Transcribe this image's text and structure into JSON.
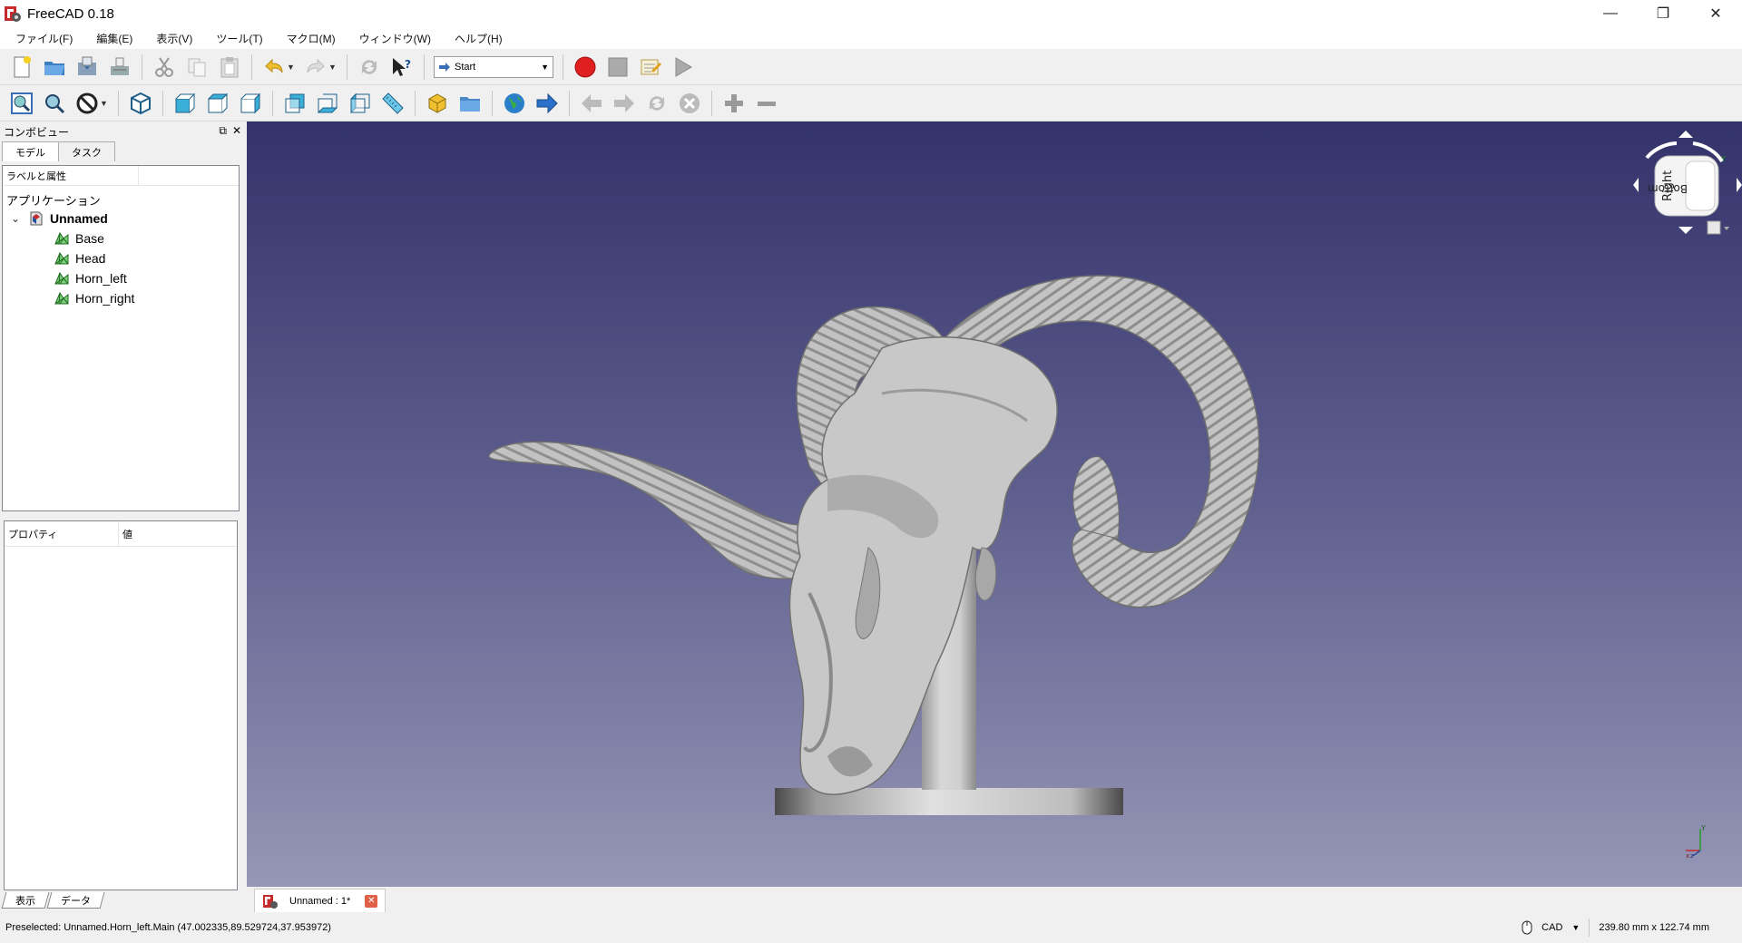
{
  "window": {
    "title": "FreeCAD 0.18",
    "controls": {
      "minimize": "—",
      "restore": "❐",
      "close": "✕"
    }
  },
  "menu": [
    "ファイル(F)",
    "編集(E)",
    "表示(V)",
    "ツール(T)",
    "マクロ(M)",
    "ウィンドウ(W)",
    "ヘルプ(H)"
  ],
  "toolbar": {
    "workbench": "Start"
  },
  "combo_view": {
    "title": "コンボビュー",
    "tabs": [
      "モデル",
      "タスク"
    ],
    "tree_header": "ラベルと属性",
    "application_label": "アプリケーション",
    "document": "Unnamed",
    "children": [
      "Base",
      "Head",
      "Horn_left",
      "Horn_right"
    ],
    "property_header": "プロパティ",
    "value_header": "値",
    "bottom_tabs": [
      "表示",
      "データ"
    ]
  },
  "document_tab": {
    "label": "Unnamed : 1*"
  },
  "navcube": {
    "face_left": "Right",
    "face_front": "Bottom"
  },
  "axis": {
    "y": "Y",
    "x": "x",
    "z": "z"
  },
  "status": {
    "message": "Preselected: Unnamed.Horn_left.Main (47.002335,89.529724,37.953972)",
    "nav_style": "CAD",
    "dimensions": "239.80 mm x 122.74 mm"
  },
  "colors": {
    "viewport_top": "#33336a",
    "viewport_bottom": "#9696b6",
    "record_red": "#e02020"
  },
  "icons": [
    "new-file-icon",
    "open-file-icon",
    "save-icon",
    "save-as-icon",
    "cut-icon",
    "copy-icon",
    "paste-icon",
    "undo-icon",
    "redo-icon",
    "refresh-icon",
    "whats-this-icon",
    "macro-record-icon",
    "macro-stop-icon",
    "macro-edit-icon",
    "macro-run-icon"
  ]
}
